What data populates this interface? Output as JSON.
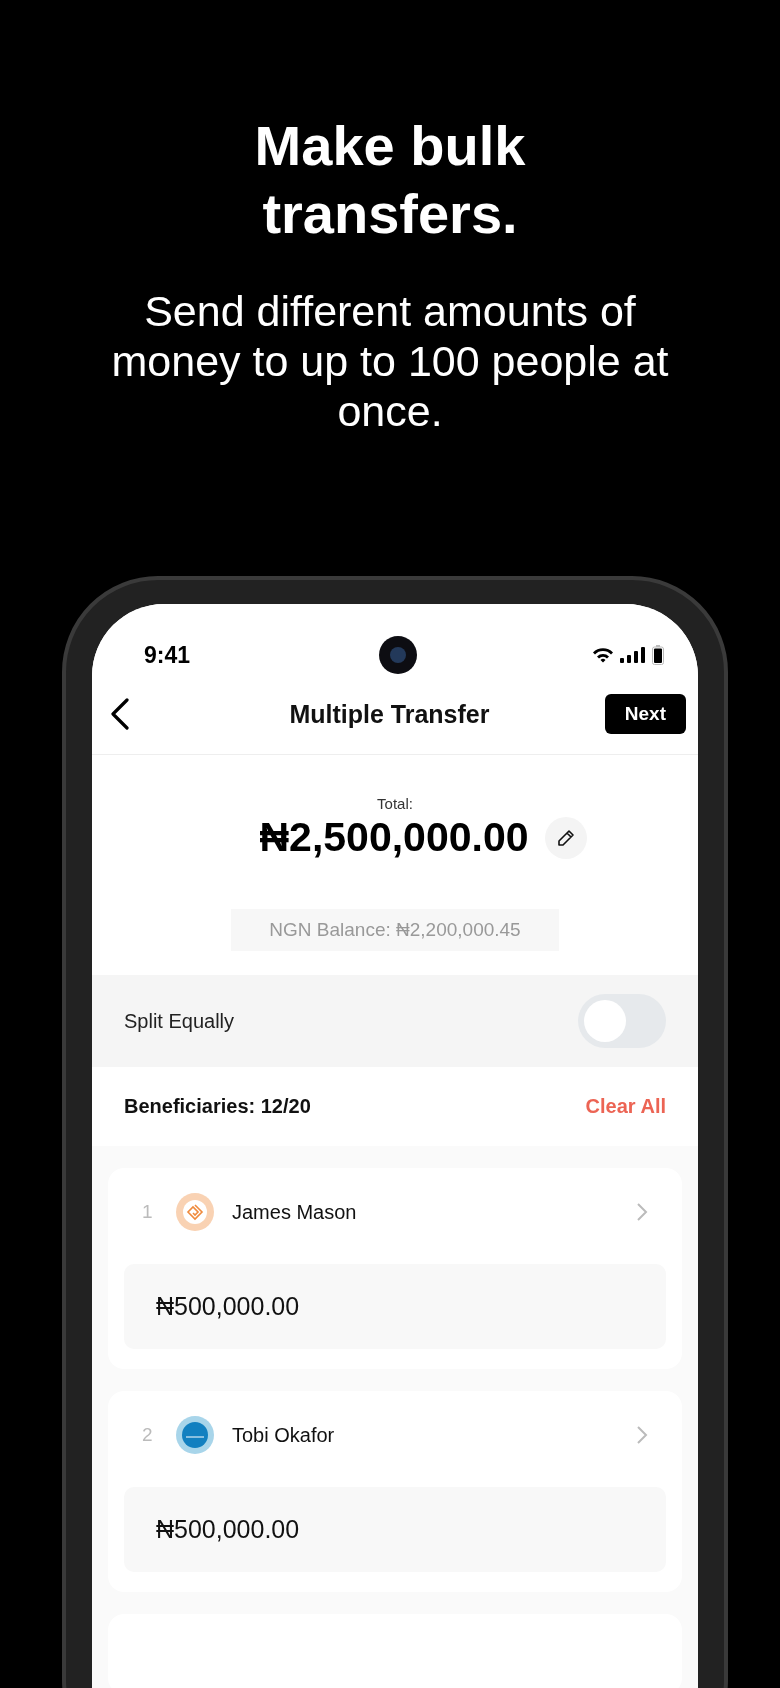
{
  "promo": {
    "headline": "Make bulk transfers.",
    "subtitle": "Send different amounts of money to up to 100 people at once."
  },
  "status_bar": {
    "time": "9:41"
  },
  "nav": {
    "title": "Multiple Transfer",
    "action": "Next"
  },
  "total": {
    "label": "Total:",
    "amount": "₦2,500,000.00"
  },
  "balance": "NGN Balance: ₦2,200,000.45",
  "split": {
    "label": "Split Equally",
    "on": false
  },
  "beneficiaries": {
    "label": "Beneficiaries: 12/20",
    "action": "Clear All",
    "items": [
      {
        "number": "1",
        "name": "James Mason",
        "amount": "₦500,000.00",
        "kind": "spiral"
      },
      {
        "number": "2",
        "name": "Tobi Okafor",
        "amount": "₦500,000.00",
        "kind": "bank"
      }
    ]
  }
}
